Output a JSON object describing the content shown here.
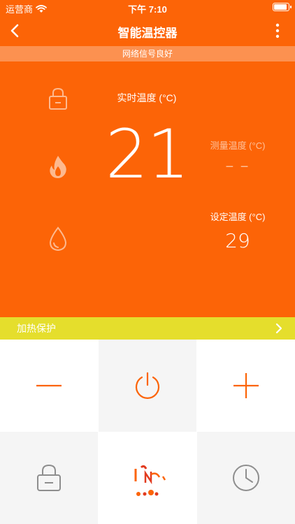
{
  "status_bar": {
    "carrier": "运营商",
    "time": "下午 7:10"
  },
  "nav": {
    "title": "智能温控器"
  },
  "network_status": "网络信号良好",
  "thermostat": {
    "realtime_label": "实时温度 (°C)",
    "realtime_value": "21",
    "measured_label": "测量温度 (°C)",
    "measured_value": "− −",
    "set_label": "设定温度 (°C)",
    "set_value": "29"
  },
  "protect_bar": {
    "label": "加热保护"
  },
  "colors": {
    "primary": "#fc6407",
    "banner": "#fc9150",
    "protect": "#e5de2c"
  },
  "icons": [
    "back-icon",
    "more-icon",
    "lock-icon",
    "flame-icon",
    "drop-icon",
    "minus-icon",
    "power-icon",
    "plus-icon",
    "clock-icon"
  ]
}
